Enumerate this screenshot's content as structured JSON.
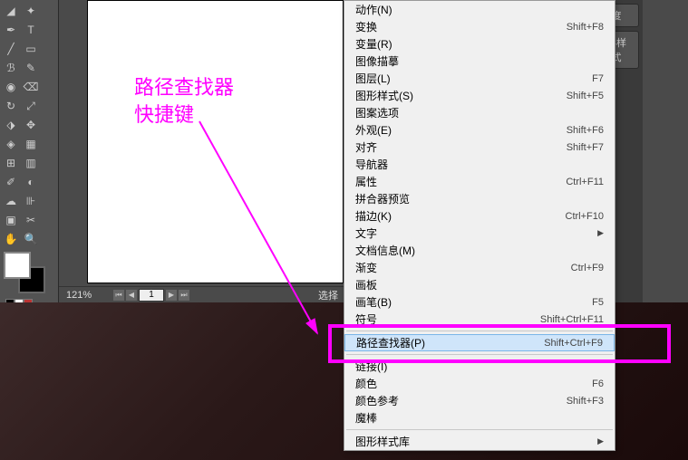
{
  "annotation": {
    "line1": "路径查找器",
    "line2": "快捷键"
  },
  "statusbar": {
    "zoom": "121%",
    "page": "1",
    "label": "选择"
  },
  "panels": {
    "opacity": "度",
    "style": "形样式"
  },
  "menu": {
    "actions": {
      "label": "动作(N)",
      "shortcut": ""
    },
    "transform": {
      "label": "变换",
      "shortcut": "Shift+F8"
    },
    "variables": {
      "label": "变量(R)",
      "shortcut": ""
    },
    "imagetrace": {
      "label": "图像描摹",
      "shortcut": ""
    },
    "layers": {
      "label": "图层(L)",
      "shortcut": "F7"
    },
    "graphicstyles": {
      "label": "图形样式(S)",
      "shortcut": "Shift+F5"
    },
    "patternoptions": {
      "label": "图案选项",
      "shortcut": ""
    },
    "appearance": {
      "label": "外观(E)",
      "shortcut": "Shift+F6"
    },
    "align": {
      "label": "对齐",
      "shortcut": "Shift+F7"
    },
    "navigator": {
      "label": "导航器",
      "shortcut": ""
    },
    "attributes": {
      "label": "属性",
      "shortcut": "Ctrl+F11"
    },
    "flattener": {
      "label": "拼合器预览",
      "shortcut": ""
    },
    "stroke": {
      "label": "描边(K)",
      "shortcut": "Ctrl+F10"
    },
    "type": {
      "label": "文字",
      "shortcut": ""
    },
    "docinfo": {
      "label": "文档信息(M)",
      "shortcut": ""
    },
    "gradient": {
      "label": "渐变",
      "shortcut": "Ctrl+F9"
    },
    "artboards": {
      "label": "画板",
      "shortcut": ""
    },
    "brushes": {
      "label": "画笔(B)",
      "shortcut": "F5"
    },
    "symbols": {
      "label": "符号",
      "shortcut": "Shift+Ctrl+F11"
    },
    "pathfinder": {
      "label": "路径查找器(P)",
      "shortcut": "Shift+Ctrl+F9"
    },
    "links": {
      "label": "链接(I)",
      "shortcut": ""
    },
    "color": {
      "label": "颜色",
      "shortcut": "F6"
    },
    "colorguide": {
      "label": "颜色参考",
      "shortcut": "Shift+F3"
    },
    "magicwand": {
      "label": "魔棒",
      "shortcut": ""
    },
    "graphiclib": {
      "label": "图形样式库",
      "shortcut": ""
    }
  }
}
